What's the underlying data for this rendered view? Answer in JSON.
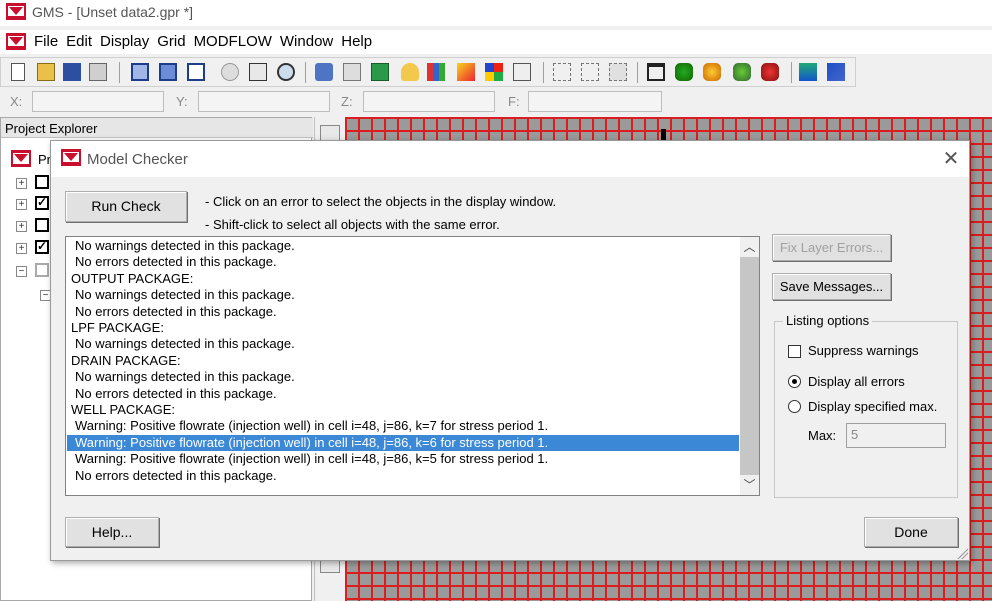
{
  "app": {
    "title": "GMS - [Unset data2.gpr *]",
    "menu": [
      "File",
      "Edit",
      "Display",
      "Grid",
      "MODFLOW",
      "Window",
      "Help"
    ]
  },
  "coords": {
    "x_label": "X:",
    "y_label": "Y:",
    "z_label": "Z:",
    "f_label": "F:"
  },
  "explorer": {
    "title": "Project Explorer",
    "root_label": "Pr"
  },
  "dialog": {
    "title": "Model Checker",
    "run_check": "Run Check",
    "hint1": "- Click on an error to select the objects in the display window.",
    "hint2": "- Shift-click to select all objects with the same error.",
    "messages": [
      {
        "text": "No warnings detected in this package.",
        "indent": true,
        "selected": false
      },
      {
        "text": "No errors detected in this package.",
        "indent": true,
        "selected": false
      },
      {
        "text": "OUTPUT PACKAGE:",
        "indent": false,
        "selected": false
      },
      {
        "text": "No warnings detected in this package.",
        "indent": true,
        "selected": false
      },
      {
        "text": "No errors detected in this package.",
        "indent": true,
        "selected": false
      },
      {
        "text": "LPF PACKAGE:",
        "indent": false,
        "selected": false
      },
      {
        "text": "No warnings detected in this package.",
        "indent": true,
        "selected": false
      },
      {
        "text": "DRAIN PACKAGE:",
        "indent": false,
        "selected": false
      },
      {
        "text": "No warnings detected in this package.",
        "indent": true,
        "selected": false
      },
      {
        "text": "No errors detected in this package.",
        "indent": true,
        "selected": false
      },
      {
        "text": "WELL PACKAGE:",
        "indent": false,
        "selected": false
      },
      {
        "text": "Warning:  Positive flowrate (injection well) in cell i=48, j=86, k=7 for stress period 1.",
        "indent": true,
        "selected": false
      },
      {
        "text": "Warning:  Positive flowrate (injection well) in cell i=48, j=86, k=6 for stress period 1.",
        "indent": true,
        "selected": true
      },
      {
        "text": "Warning:  Positive flowrate (injection well) in cell i=48, j=86, k=5 for stress period 1.",
        "indent": true,
        "selected": false
      },
      {
        "text": "No errors detected in this package.",
        "indent": true,
        "selected": false
      }
    ],
    "fix_layer_errors": "Fix Layer Errors...",
    "save_messages": "Save Messages...",
    "listing_options": "Listing options",
    "suppress_warnings": "Suppress warnings",
    "display_all": "Display all errors",
    "display_max": "Display specified max.",
    "max_label": "Max:",
    "max_value": "5",
    "help": "Help...",
    "done": "Done"
  },
  "colors": {
    "grid_line": "#d81e1e",
    "grid_fill": "#9a9a9a",
    "selection": "#3a88d6",
    "logo": "#c8102e"
  }
}
